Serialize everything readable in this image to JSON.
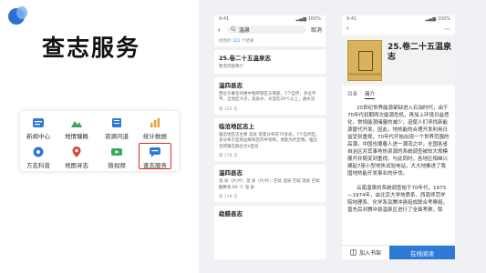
{
  "heading": "查志服务",
  "services": [
    {
      "label": "新闻中心",
      "icon": "news-icon",
      "color": "#2f79d6"
    },
    {
      "label": "地情慷概",
      "icon": "mountain-icon",
      "color": "#3aa75a"
    },
    {
      "label": "资源问道",
      "icon": "book-icon",
      "color": "#2f79d6"
    },
    {
      "label": "统计数据",
      "icon": "bar-chart-icon",
      "color": "#e1a23a"
    },
    {
      "label": "方志科普",
      "icon": "science-icon",
      "color": "#2f79d6"
    },
    {
      "label": "地图寻志",
      "icon": "map-pin-icon",
      "color": "#d2493a"
    },
    {
      "label": "微视频",
      "icon": "video-icon",
      "color": "#3aa75a"
    },
    {
      "label": "查志服务",
      "icon": "chat-icon",
      "color": "#2f79d6"
    }
  ],
  "phone1": {
    "status_left": "9:41",
    "status_right": "▂▄▆ 100%",
    "query": "温泉",
    "cancel": "取消",
    "count_prefix": "找到约",
    "count": "121",
    "count_suffix": "个结果",
    "results": [
      {
        "title": "25.卷二十五温泉志",
        "body": "暂无内容简介",
        "page": ""
      },
      {
        "title": "温四县志",
        "body": "西位于番名的楼中物所管区东南部，7个自然，多位平平，全地区冷点，温泉水，水温在29℃以上，通水流",
        "page": "第 103 页"
      },
      {
        "title": "临沧地区志上",
        "body": "临沧地区志主要 温泉 等量分布有70多处，7个自然区，多分布于监地边缘等区的中等断，地能为代区略。临沧克所属在群位为V型谷",
        "page": "第 178 页"
      },
      {
        "title": "温四县志",
        "body": "温 泉（片/片）温 泉（片/片）芒蚌 温泉 芒蚌 温泉 芒蚌 翻佛系 60 ℃ 温 泉",
        "page": "第 118 页"
      },
      {
        "title": "勐腊县志",
        "body": "",
        "page": ""
      }
    ]
  },
  "phone2": {
    "status_left": "9:41",
    "status_right": "▂▄▆ 100%",
    "title": "25.卷二十五温泉志",
    "tab_catalog": "目录",
    "tab_intro": "简介",
    "para1": "20世纪世界能源紧缺进入石油时代，由于70年代初期两次能源危机，再加上环境日益恶化，常规能源储量的减少，迫使人们寻找新能源替代开发。因此，地热能的合理开发利用日益受到重视，70年代开始出现一个世界范围的高潮，中国也顺春人进一潮流之中，全国各省自治区对其事地热资源的系统调查被较大规模展开并随变到重视，与此同时，各地区相继兴建起7座小型地热试验电站，大大地推进了我国地热能开发事业的步伐。",
    "para2": "云南温泉的系统调查始于70年代，1973—1974年，由北京大学地质系、西南师范学院地理系、化学系及腾冲县组成联合考察组，曾先后对腾冲县温泉区进行了全面考察，取",
    "shelf": "加入书架",
    "read": "在线阅读"
  }
}
